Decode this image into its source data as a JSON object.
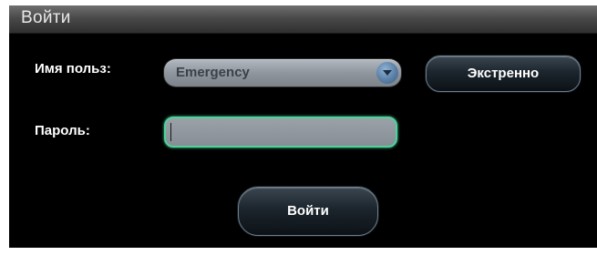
{
  "window": {
    "title": "Войти"
  },
  "form": {
    "username_label": "Имя польз:",
    "username_value": "Emergency",
    "password_label": "Пароль:",
    "password_value": ""
  },
  "buttons": {
    "emergency_label": "Экстренно",
    "login_label": "Войти"
  },
  "colors": {
    "dialog_background": "#000000",
    "focus_border": "#4fd39a"
  }
}
